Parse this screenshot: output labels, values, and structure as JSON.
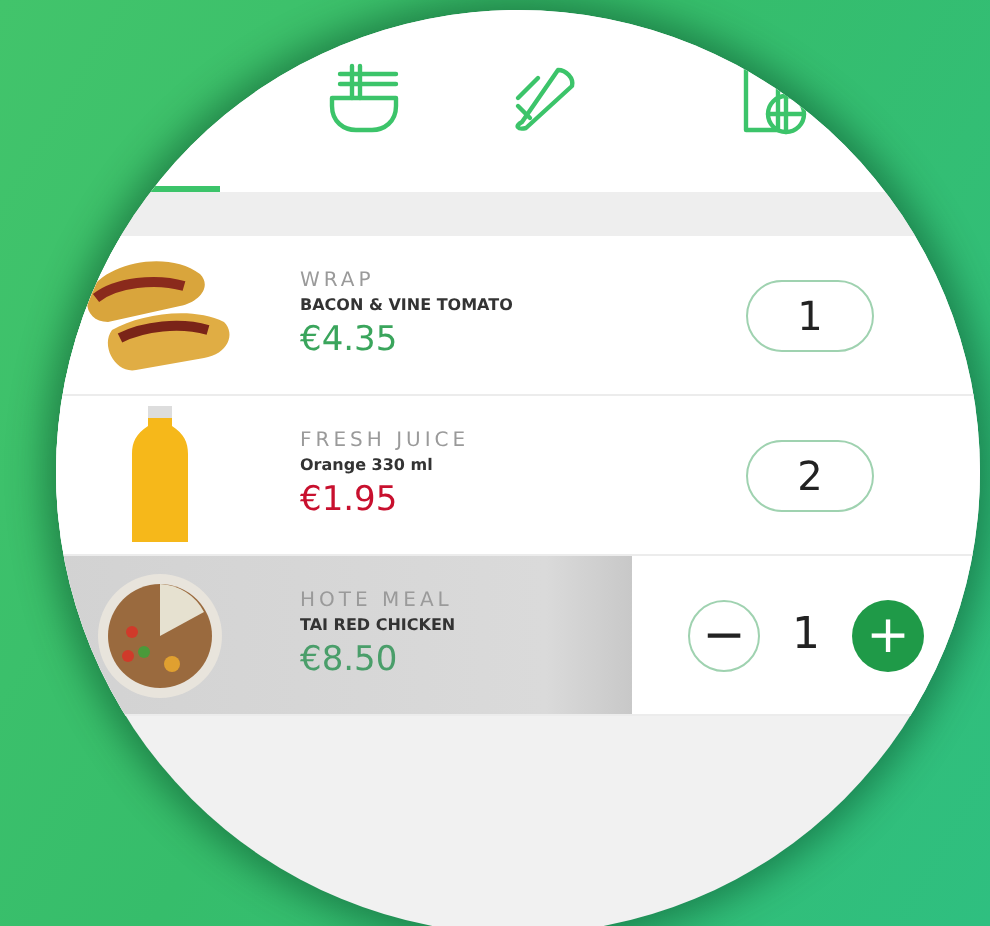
{
  "tabs": [
    {
      "selected": true
    },
    {
      "kind": "noodles",
      "selected": false
    },
    {
      "kind": "wrap",
      "selected": false
    },
    {
      "kind": "juice",
      "selected": false
    }
  ],
  "items": [
    {
      "kind": "wrap",
      "category": "WRAP",
      "name": "BACON & VINE TOMATO",
      "price": "€4.35",
      "color": "#3aa55c",
      "quantity": "1",
      "selected": false
    },
    {
      "kind": "juice",
      "category": "FRESH JUICE",
      "name": "Orange 330 ml",
      "price": "€1.95",
      "color": "#c8102e",
      "quantity": "2",
      "selected": false
    },
    {
      "kind": "bowl",
      "category": "HOTE MEAL",
      "name": "TAI RED CHICKEN",
      "price": "€8.50",
      "color": "#4a9e6a",
      "quantity": "1",
      "selected": true,
      "minus": "−",
      "plus": "+"
    }
  ]
}
